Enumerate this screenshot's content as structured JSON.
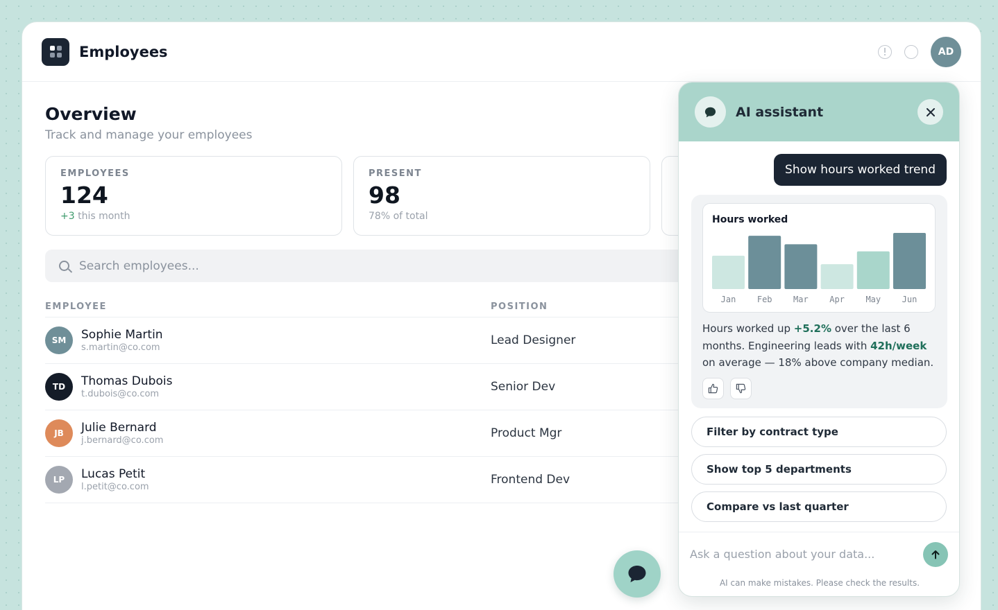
{
  "app": {
    "title": "Employees",
    "user_initials": "AD"
  },
  "overview": {
    "title": "Overview",
    "subtitle": "Track and manage your employees"
  },
  "stats": [
    {
      "label": "EMPLOYEES",
      "value": "124",
      "note_highlight": "+3",
      "note": " this month"
    },
    {
      "label": "PRESENT",
      "value": "98",
      "note_highlight": "",
      "note": "78% of total"
    }
  ],
  "search": {
    "placeholder": "Search employees..."
  },
  "table": {
    "columns": [
      "EMPLOYEE",
      "POSITION"
    ],
    "rows": [
      {
        "initials": "SM",
        "name": "Sophie Martin",
        "email": "s.martin@co.com",
        "position": "Lead Designer",
        "color": "#6f8f98"
      },
      {
        "initials": "TD",
        "name": "Thomas Dubois",
        "email": "t.dubois@co.com",
        "position": "Senior Dev",
        "color": "#141c28"
      },
      {
        "initials": "JB",
        "name": "Julie Bernard",
        "email": "j.bernard@co.com",
        "position": "Product Mgr",
        "color": "#de8a5a"
      },
      {
        "initials": "LP",
        "name": "Lucas Petit",
        "email": "l.petit@co.com",
        "position": "Frontend Dev",
        "color": "#a3a8b1"
      }
    ]
  },
  "assistant": {
    "title": "AI assistant",
    "user_message": "Show hours worked trend",
    "response_parts": {
      "p1": "Hours worked up ",
      "h1": "+5.2%",
      "p2": " over the last 6 months. Engineering leads with ",
      "h2": "42h/week",
      "p3": " on average — 18% above company median."
    },
    "suggestions": [
      "Filter by contract type",
      "Show top 5 departments",
      "Compare vs last quarter"
    ],
    "input_placeholder": "Ask a question about your data...",
    "disclaimer": "AI can make mistakes. Please check the results."
  },
  "chart_data": {
    "type": "bar",
    "title": "Hours worked",
    "categories": [
      "Jan",
      "Feb",
      "Mar",
      "Apr",
      "May",
      "Jun"
    ],
    "values": [
      47,
      75,
      63,
      35,
      53,
      79
    ],
    "bar_colors": [
      "#cde7e1",
      "#6c8f99",
      "#6c8f99",
      "#cde7e1",
      "#a9d6cb",
      "#6c8f99"
    ]
  },
  "colors": {
    "accent": "#aad5cb",
    "dark": "#1b2533",
    "positive": "#3f9b6d"
  },
  "icons": [
    "logo-icon",
    "alert-icon",
    "circle-icon",
    "search-icon",
    "chat-bubble-icon",
    "close-icon",
    "thumbs-up-icon",
    "thumbs-down-icon",
    "send-arrow-icon"
  ]
}
